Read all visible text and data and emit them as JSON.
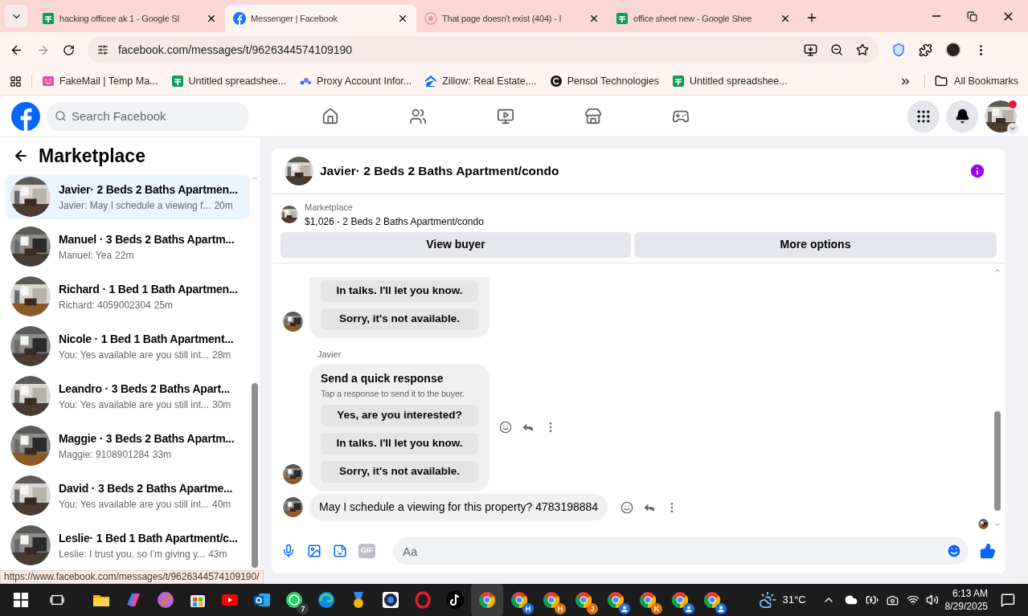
{
  "browser": {
    "tabs": [
      {
        "kind": "sheets",
        "title": "hacking officee ak 1 - Google Sl",
        "selected": false
      },
      {
        "kind": "facebook",
        "title": "Messenger | Facebook",
        "selected": true
      },
      {
        "kind": "error",
        "title": "That page doesn't exist (404) - I",
        "selected": false
      },
      {
        "kind": "sheets",
        "title": "office sheet new - Google Shee",
        "selected": false
      }
    ],
    "url": "facebook.com/messages/t/9626344574109190",
    "bookmarks": [
      {
        "kind": "fakemail",
        "label": "FakeMail | Temp Ma..."
      },
      {
        "kind": "sheets",
        "label": "Untitled spreadshee..."
      },
      {
        "kind": "proxy",
        "label": "Proxy Account Infor..."
      },
      {
        "kind": "zillow",
        "label": "Zillow: Real Estate,..."
      },
      {
        "kind": "pensol",
        "label": "Pensol Technologies"
      },
      {
        "kind": "sheets",
        "label": "Untitled spreadshee..."
      }
    ],
    "all_bookmarks": "All Bookmarks",
    "status_url": "https://www.facebook.com/messages/t/9626344574109190/"
  },
  "facebook": {
    "search": {
      "placeholder": "Search Facebook"
    },
    "nav": [
      {
        "kind": "home",
        "selected": false
      },
      {
        "kind": "friends",
        "selected": false
      },
      {
        "kind": "video",
        "selected": false
      },
      {
        "kind": "marketplace",
        "selected": false
      },
      {
        "kind": "gaming",
        "selected": false
      }
    ],
    "profile_notification": true
  },
  "sidebar": {
    "title": "Marketplace",
    "conversations": [
      {
        "title": "Javier· 2 Beds 2 Baths Apartmen...",
        "preview": "Javier: May I schedule a viewing f...",
        "time": "20m",
        "selected": true
      },
      {
        "title": "Manuel · 3 Beds 2 Baths Apartm...",
        "preview": "Manuel: Yea",
        "time": "22m",
        "selected": false
      },
      {
        "title": "Richard · 1 Bed 1 Bath Apartmen...",
        "preview": "Richard: 4059002304",
        "time": "25m",
        "selected": false
      },
      {
        "title": "Nicole · 1 Bed 1 Bath Apartment...",
        "preview": "You: Yes available are you still int...",
        "time": "28m",
        "selected": false
      },
      {
        "title": "Leandro · 3 Beds 2 Baths Apart...",
        "preview": "You: Yes available are you still int...",
        "time": "30m",
        "selected": false
      },
      {
        "title": "Maggie · 3 Beds 2 Baths Apartm...",
        "preview": "Maggie: 9108901284",
        "time": "33m",
        "selected": false
      },
      {
        "title": "David · 3 Beds 2 Baths Apartme...",
        "preview": "You: Yes available are you still int...",
        "time": "40m",
        "selected": false
      },
      {
        "title": "Leslie· 1 Bed 1 Bath Apartment/c...",
        "preview": "Leslie: I trust you, so I'm giving y...",
        "time": "43m",
        "selected": false
      }
    ]
  },
  "chat": {
    "title": "Javier· 2 Beds 2 Baths Apartment/condo",
    "listing": {
      "label": "Marketplace",
      "detail": "$1,026 - 2 Beds 2 Baths Apartment/condo"
    },
    "actions": [
      "View buyer",
      "More options"
    ],
    "messages": [
      {
        "kind": "quick_replies",
        "options": [
          "In talks. I'll let you know.",
          "Sorry, it's not available."
        ]
      },
      {
        "kind": "quick_replies",
        "sender": "Javier",
        "title": "Send a quick response",
        "subtitle": "Tap a response to send it to the buyer.",
        "options": [
          "Yes, are you interested?",
          "In talks. I'll let you know.",
          "Sorry, it's not available."
        ]
      },
      {
        "kind": "text",
        "text": "May I schedule a viewing for this property? 4783198884"
      }
    ],
    "composer": {
      "placeholder": "Aa",
      "gif_label": "GIF"
    }
  },
  "taskbar": {
    "apps": [
      {
        "kind": "explorer",
        "selected": false
      },
      {
        "kind": "copilot",
        "selected": false
      },
      {
        "kind": "orb",
        "selected": false
      },
      {
        "kind": "store",
        "selected": false
      },
      {
        "kind": "youtube",
        "selected": false
      },
      {
        "kind": "outlook",
        "selected": false
      },
      {
        "kind": "whatsapp",
        "badge": "7",
        "selected": false
      },
      {
        "kind": "edge",
        "selected": false
      },
      {
        "kind": "medal",
        "selected": false
      },
      {
        "kind": "badge",
        "selected": false
      },
      {
        "kind": "opera",
        "selected": false
      },
      {
        "kind": "tiktok",
        "selected": false
      },
      {
        "kind": "chrome",
        "selected": true
      },
      {
        "kind": "chrome",
        "badge": "H",
        "color": "#1a73e8",
        "selected": false
      },
      {
        "kind": "chrome",
        "badge": "H",
        "color": "#e8710a",
        "selected": false
      },
      {
        "kind": "chrome",
        "badge": "J",
        "color": "#e8710a",
        "selected": false
      },
      {
        "kind": "chrome_profile",
        "color": "#1a73e8",
        "selected": false
      },
      {
        "kind": "chrome",
        "badge": "K",
        "color": "#e8710a",
        "selected": false
      },
      {
        "kind": "chrome_profile",
        "color": "#1a73e8",
        "selected": false
      },
      {
        "kind": "chrome_profile",
        "color": "#1a73e8",
        "selected": false
      }
    ],
    "temperature": "31°C",
    "time": "6:13 AM",
    "date": "8/29/2025"
  }
}
